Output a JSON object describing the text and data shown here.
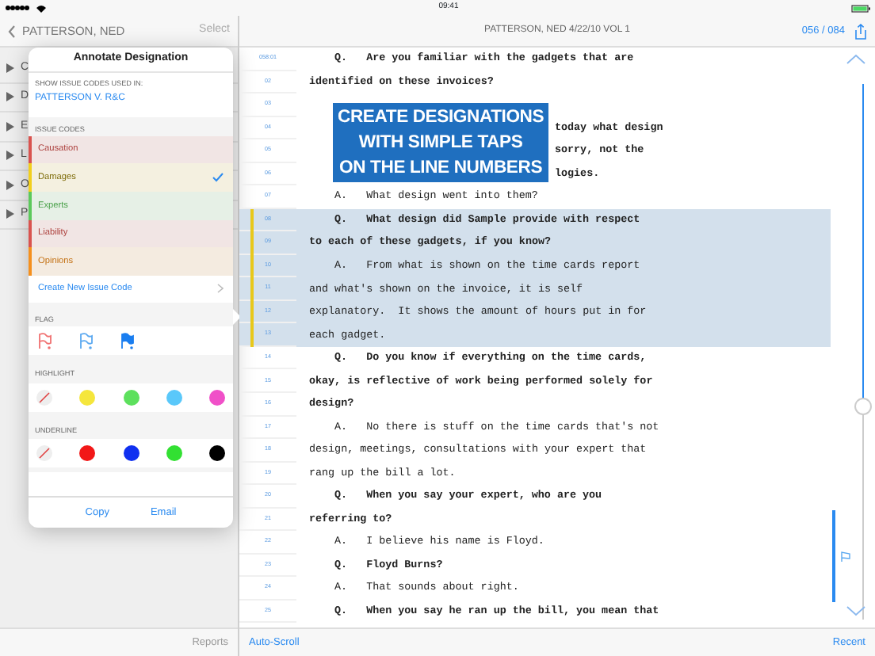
{
  "status_bar": {
    "time": "09:41"
  },
  "left_nav": {
    "back_label": "PATTERSON, NED",
    "action": "Select"
  },
  "background_list": [
    {
      "text": "C"
    },
    {
      "text": "D"
    },
    {
      "text": "E"
    },
    {
      "text": "L"
    },
    {
      "text": "O"
    },
    {
      "text": "P"
    }
  ],
  "popover": {
    "title": "Annotate Designation",
    "source_label": "SHOW ISSUE CODES USED IN:",
    "source_value": "PATTERSON V. R&C",
    "issue_codes_label": "ISSUE CODES",
    "issue_codes": [
      {
        "label": "Causation",
        "color": "#d9534f",
        "checked": false
      },
      {
        "label": "Damages",
        "color": "#f2cf1d",
        "checked": true
      },
      {
        "label": "Experts",
        "color": "#5cc95c",
        "checked": false
      },
      {
        "label": "Liability",
        "color": "#d9534f",
        "checked": false
      },
      {
        "label": "Opinions",
        "color": "#f5901e",
        "checked": false
      }
    ],
    "create_label": "Create New Issue Code",
    "flag_label": "FLAG",
    "flags": [
      {
        "kind": "outline",
        "color": "#f07070"
      },
      {
        "kind": "outline",
        "color": "#5aa8f0"
      },
      {
        "kind": "filled",
        "color": "#1a7ef0"
      }
    ],
    "highlight_label": "HIGHLIGHT",
    "highlights": [
      {
        "kind": "none"
      },
      {
        "kind": "color",
        "color": "#f5e63c"
      },
      {
        "kind": "color",
        "color": "#5de05d"
      },
      {
        "kind": "color",
        "color": "#5ac8fa"
      },
      {
        "kind": "color",
        "color": "#f050c8"
      }
    ],
    "underline_label": "UNDERLINE",
    "underlines": [
      {
        "kind": "none"
      },
      {
        "kind": "color",
        "color": "#f21818"
      },
      {
        "kind": "color",
        "color": "#1030f0"
      },
      {
        "kind": "color",
        "color": "#32e032"
      },
      {
        "kind": "color",
        "color": "#000000"
      }
    ],
    "actions": [
      "Copy",
      "Email"
    ]
  },
  "transcript_nav": {
    "title": "PATTERSON, NED 4/22/10 VOL 1",
    "page": "056 / 084"
  },
  "banner": {
    "lines": [
      "CREATE DESIGNATIONS",
      "WITH SIMPLE TAPS",
      "ON THE LINE NUMBERS"
    ]
  },
  "lines": [
    {
      "number": "058:01",
      "text": "Q.   Are you familiar with the gadgets that are",
      "kind": "indent",
      "bold": true,
      "highlighted": false
    },
    {
      "number": "02",
      "text": "identified on these invoices?",
      "kind": "plain",
      "bold": true,
      "highlighted": false
    },
    {
      "number": "03",
      "highlighted": false
    },
    {
      "number": "04",
      "text": "today what design",
      "kind": "covered",
      "bold": true,
      "highlighted": false
    },
    {
      "number": "05",
      "text": "sorry, not the",
      "kind": "covered",
      "bold": true,
      "highlighted": false
    },
    {
      "number": "06",
      "text": "logies.",
      "kind": "covered",
      "bold": true,
      "highlighted": false
    },
    {
      "number": "07",
      "text": "A.   What design went into them?",
      "kind": "indent",
      "bold": false,
      "highlighted": false
    },
    {
      "number": "08",
      "text": "Q.   What design did Sample provide with respect",
      "kind": "indent",
      "bold": true,
      "highlighted": true
    },
    {
      "number": "09",
      "text": "to each of these gadgets, if you know?",
      "kind": "plain",
      "bold": true,
      "highlighted": true
    },
    {
      "number": "10",
      "text": "A.   From what is shown on the time cards report",
      "kind": "indent",
      "bold": false,
      "highlighted": true
    },
    {
      "number": "11",
      "text": "and what's shown on the invoice, it is self",
      "kind": "plain",
      "bold": false,
      "highlighted": true
    },
    {
      "number": "12",
      "text": "explanatory.  It shows the amount of hours put in for",
      "kind": "plain",
      "bold": false,
      "highlighted": true
    },
    {
      "number": "13",
      "text": "each gadget.",
      "kind": "plain",
      "bold": false,
      "highlighted": true
    },
    {
      "number": "14",
      "text": "Q.   Do you know if everything on the time cards,",
      "kind": "indent",
      "bold": true,
      "highlighted": false
    },
    {
      "number": "15",
      "text": "okay, is reflective of work being performed solely for",
      "kind": "plain",
      "bold": true,
      "highlighted": false
    },
    {
      "number": "16",
      "text": "design?",
      "kind": "plain",
      "bold": true,
      "highlighted": false
    },
    {
      "number": "17",
      "text": "A.   No there is stuff on the time cards that's not",
      "kind": "indent",
      "bold": false,
      "highlighted": false
    },
    {
      "number": "18",
      "text": "design, meetings, consultations with your expert that",
      "kind": "plain",
      "bold": false,
      "highlighted": false
    },
    {
      "number": "19",
      "text": "rang up the bill a lot.",
      "kind": "plain",
      "bold": false,
      "highlighted": false
    },
    {
      "number": "20",
      "text": "Q.   When you say your expert, who are you",
      "kind": "indent",
      "bold": true,
      "highlighted": false
    },
    {
      "number": "21",
      "text": "referring to?",
      "kind": "plain",
      "bold": true,
      "highlighted": false
    },
    {
      "number": "22",
      "text": "A.   I believe his name is Floyd.",
      "kind": "indent",
      "bold": false,
      "highlighted": false
    },
    {
      "number": "23",
      "text": "Q.   Floyd Burns?",
      "kind": "indent",
      "bold": true,
      "highlighted": false
    },
    {
      "number": "24",
      "text": "A.   That sounds about right.",
      "kind": "indent",
      "bold": false,
      "highlighted": false
    },
    {
      "number": "25",
      "text": "Q.   When you say he ran up the bill, you mean that",
      "kind": "indent",
      "bold": true,
      "highlighted": false
    }
  ],
  "position_slider": {
    "level": 0.6
  },
  "toolbar": {
    "left": "Reports",
    "auto_scroll": "Auto-Scroll",
    "recent": "Recent"
  }
}
